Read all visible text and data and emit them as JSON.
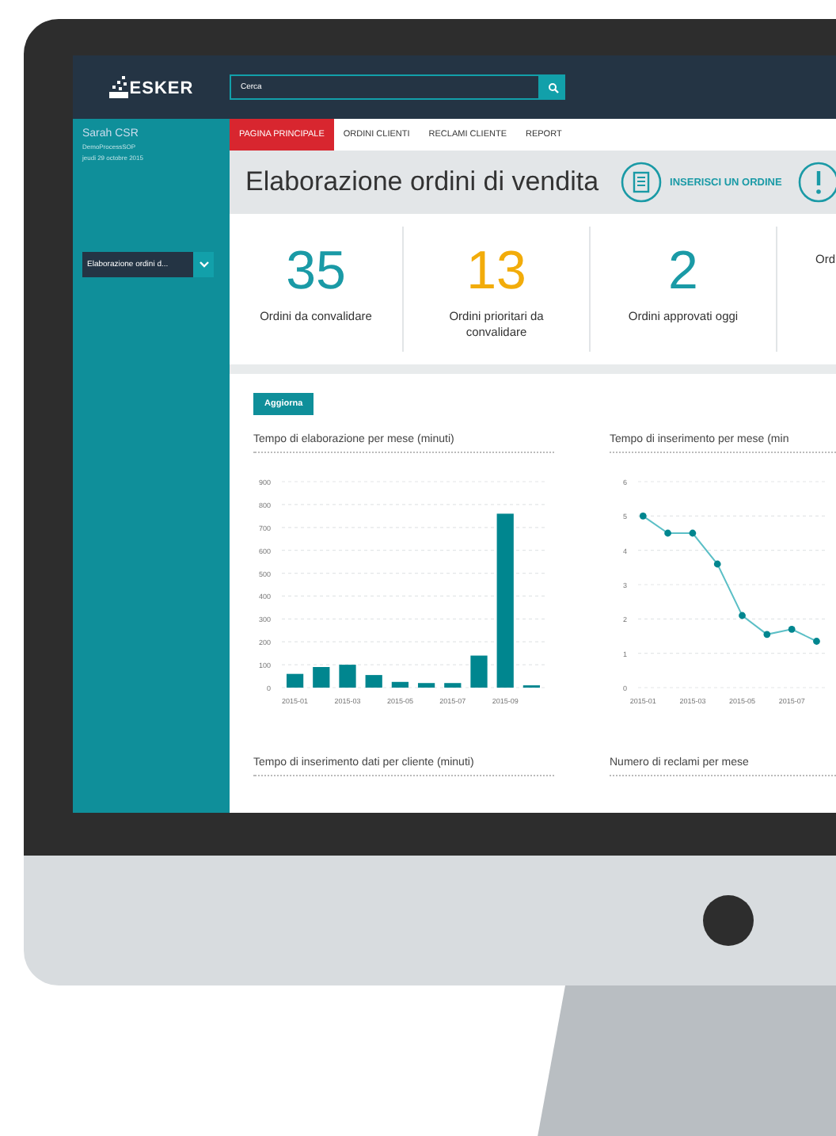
{
  "header": {
    "logo": "ESKER",
    "search": {
      "placeholder": "Cerca"
    }
  },
  "sidebar": {
    "user": "Sarah CSR",
    "process": "DemoProcessSOP",
    "date": "jeudi 29 octobre 2015",
    "dropdown": {
      "value": "Elaborazione ordini d..."
    }
  },
  "tabs": [
    {
      "label": "PAGINA PRINCIPALE",
      "selected": true
    },
    {
      "label": "ORDINI CLIENTI",
      "selected": false
    },
    {
      "label": "RECLAMI CLIENTE",
      "selected": false
    },
    {
      "label": "REPORT",
      "selected": false
    }
  ],
  "title": "Elaborazione ordini di vendita",
  "actions": [
    {
      "kind": "document",
      "label": "INSERISCI UN ORDINE"
    },
    {
      "kind": "alert"
    }
  ],
  "kpis": [
    {
      "value": "35",
      "label": "Ordini da convalidare",
      "color": "#1a9aa6"
    },
    {
      "value": "13",
      "label": "Ordini prioritari da convalidare",
      "color": "#f2ac0a"
    },
    {
      "value": "2",
      "label": "Ordini approvati oggi",
      "color": "#1a9aa6"
    },
    {
      "label": "Ord"
    }
  ],
  "refresh_button": "Aggiorna",
  "charts": [
    {
      "title": "Tempo di elaborazione per mese (minuti)",
      "chart_data": {
        "type": "bar",
        "categories": [
          "2015-01",
          null,
          "2015-03",
          null,
          "2015-05",
          null,
          "2015-07",
          null,
          "2015-09",
          null
        ],
        "series": [
          {
            "color": "#00868f",
            "values": [
              60,
              90,
              100,
              55,
              25,
              20,
              20,
              140,
              760,
              10
            ]
          }
        ],
        "ylim": [
          0,
          900
        ],
        "yticks": [
          0,
          100,
          200,
          300,
          400,
          500,
          600,
          700,
          800,
          900
        ],
        "grid": true
      }
    },
    {
      "title": "Tempo di inserimento per mese (min",
      "chart_data": {
        "type": "line",
        "categories": [
          "2015-01",
          null,
          "2015-03",
          null,
          "2015-05",
          null,
          "2015-07",
          null
        ],
        "series": [
          {
            "color": "#5bbfc6",
            "marker": "circle",
            "values": [
              5,
              4.5,
              4.5,
              3.6,
              2.1,
              1.55,
              1.7,
              1.35
            ]
          }
        ],
        "ylim": [
          0,
          6
        ],
        "yticks": [
          0,
          1,
          2,
          3,
          4,
          5,
          6
        ],
        "grid": true
      }
    },
    {
      "title": "Tempo di inserimento dati per cliente (minuti)"
    },
    {
      "title": "Numero di reclami per mese"
    }
  ]
}
